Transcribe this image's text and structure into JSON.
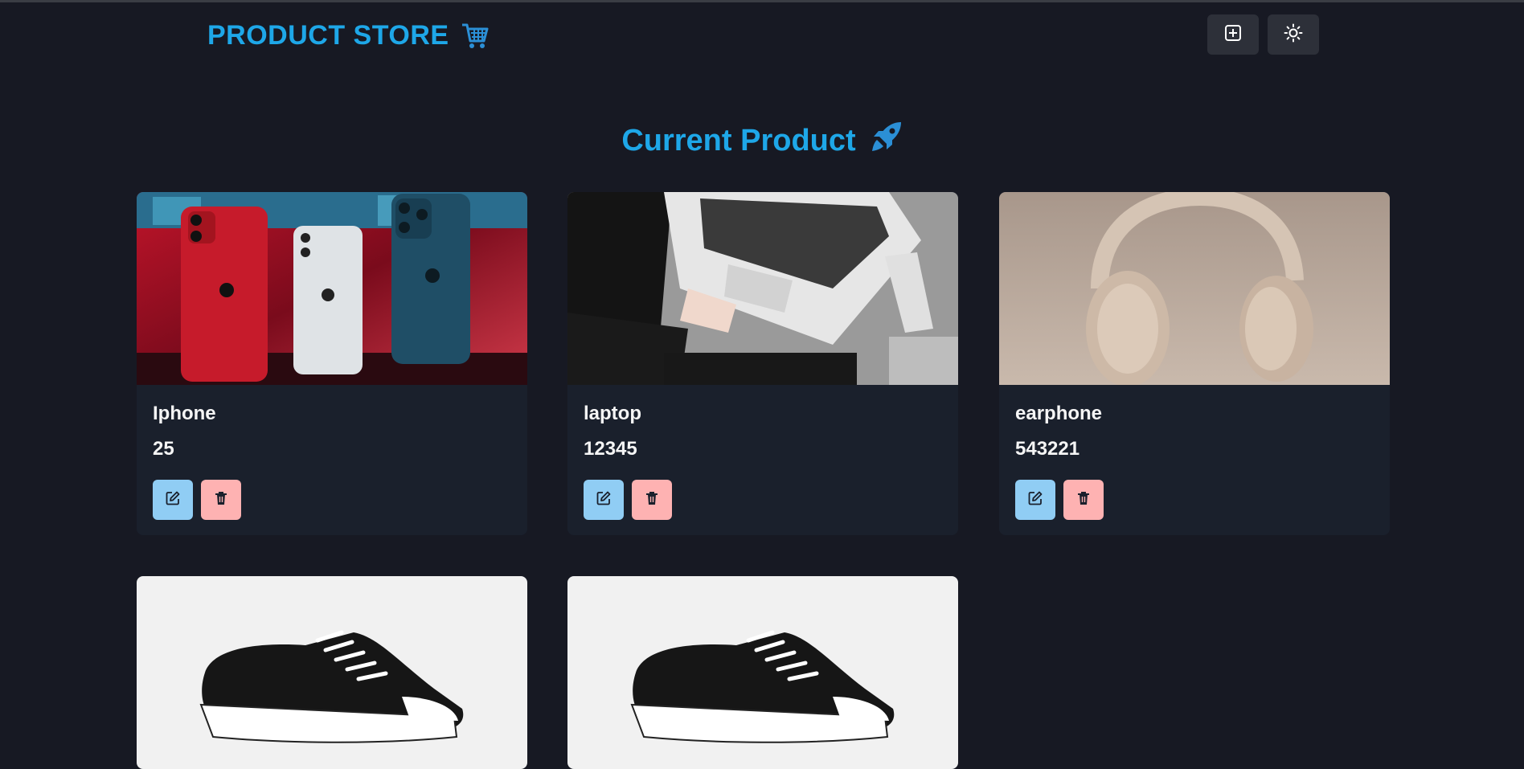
{
  "header": {
    "brand": "PRODUCT STORE",
    "brand_icon": "shopping-cart-icon",
    "add_icon": "plus-square-icon",
    "theme_icon": "sun-icon"
  },
  "main": {
    "title": "Current Product",
    "title_icon": "rocket-icon"
  },
  "products": [
    {
      "name": "Iphone",
      "price": "25",
      "image": "iphone-photo"
    },
    {
      "name": "laptop",
      "price": "12345",
      "image": "laptop-photo"
    },
    {
      "name": "earphone",
      "price": "543221",
      "image": "headphones-photo"
    },
    {
      "name": "",
      "price": "",
      "image": "sneaker-photo"
    },
    {
      "name": "",
      "price": "",
      "image": "sneaker-photo"
    }
  ],
  "colors": {
    "background": "#171923",
    "card": "#1a202c",
    "accent": "#1ea7e8",
    "edit_button": "#90cdf4",
    "delete_button": "#feb2b2"
  }
}
